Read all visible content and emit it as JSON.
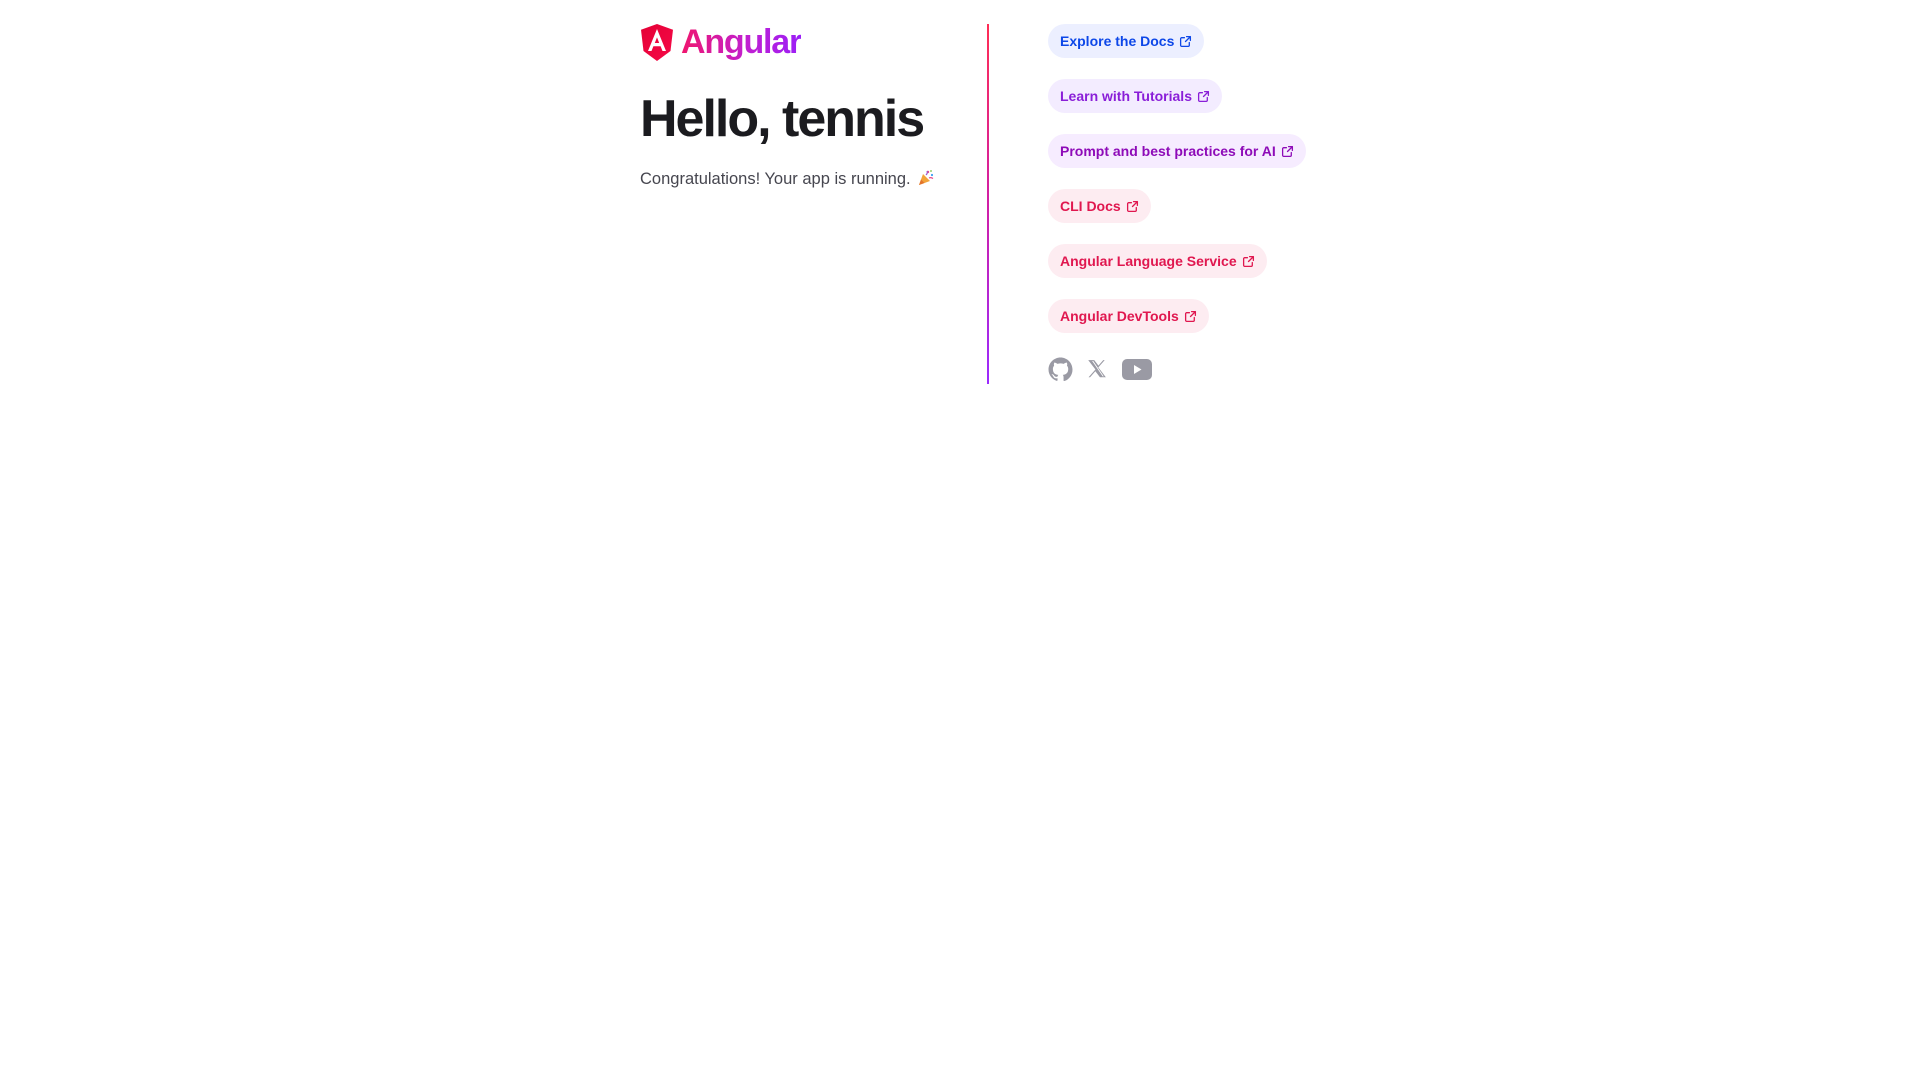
{
  "brand": {
    "wordmark": "Angular"
  },
  "hero": {
    "title": "Hello, tennis",
    "subtitle": "Congratulations! Your app is running."
  },
  "links": [
    {
      "label": "Explore the Docs",
      "color": "#0d47e8",
      "background": "#ecefff"
    },
    {
      "label": "Learn with Tutorials",
      "color": "#8a1ed8",
      "background": "#f3ecff"
    },
    {
      "label": "Prompt and best practices for AI",
      "color": "#8e0bb8",
      "background": "#f6ecff"
    },
    {
      "label": "CLI Docs",
      "color": "#e0174f",
      "background": "#fdecf1"
    },
    {
      "label": "Angular Language Service",
      "color": "#e0174f",
      "background": "#fdecf1"
    },
    {
      "label": "Angular DevTools",
      "color": "#e0174f",
      "background": "#fdecf1"
    }
  ],
  "socials": [
    {
      "icon": "github-icon"
    },
    {
      "icon": "x-icon"
    },
    {
      "icon": "youtube-icon"
    }
  ],
  "colors": {
    "social_icon": "#9a9aa4",
    "text_primary": "#1b1b1f",
    "text_secondary": "#46464f"
  }
}
